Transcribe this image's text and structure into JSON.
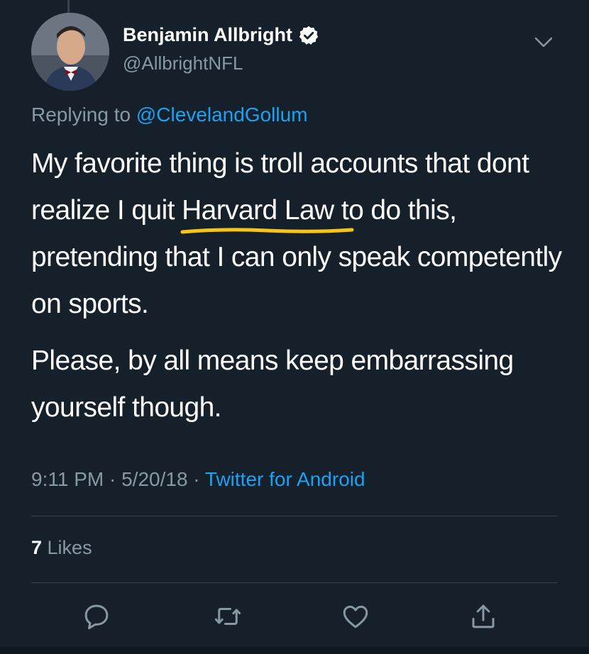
{
  "author": {
    "name": "Benjamin Allbright",
    "handle": "@AllbrightNFL",
    "verified": true
  },
  "reply": {
    "prefix": "Replying to ",
    "mention": "@ClevelandGollum"
  },
  "tweet": {
    "paragraph1": "My favorite thing is troll accounts that dont realize I quit Harvard Law to do this, pretending that I can only speak competently on sports.",
    "paragraph2": "Please, by all means keep embarrassing yourself though."
  },
  "meta": {
    "time": "9:11 PM",
    "separator1": " · ",
    "date": "5/20/18",
    "separator2": " · ",
    "source": "Twitter for Android"
  },
  "engagement": {
    "likes_count": "7",
    "likes_label": " Likes"
  },
  "actions": {
    "reply_icon": "reply-icon",
    "retweet_icon": "retweet-icon",
    "like_icon": "heart-icon",
    "share_icon": "share-icon"
  },
  "colors": {
    "background": "#15202b",
    "text": "#ffffff",
    "secondary": "#8899a6",
    "link": "#1da1f2",
    "highlight": "#f5c518",
    "divider": "#38444d"
  }
}
